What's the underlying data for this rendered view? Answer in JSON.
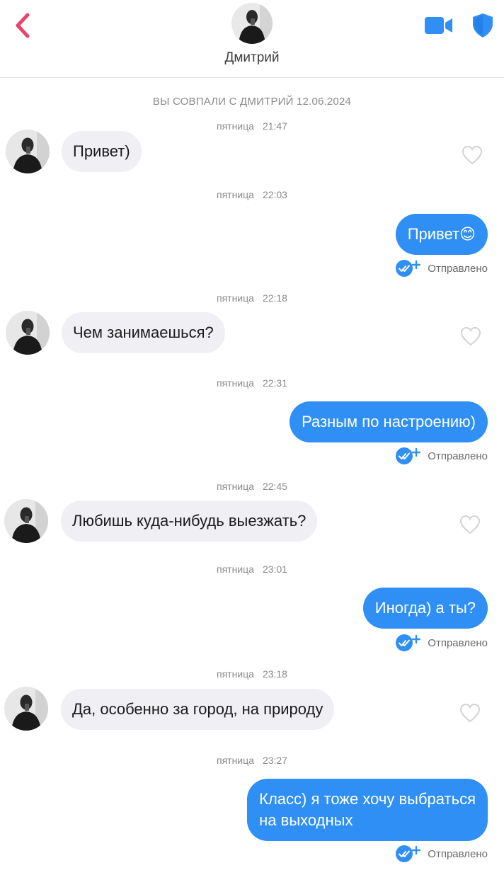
{
  "header": {
    "name": "Дмитрий",
    "accent_color": "#e8456b",
    "brand_color": "#2f8ff5",
    "icons": [
      "back-chevron-icon",
      "video-camera-icon",
      "shield-icon"
    ]
  },
  "chat": {
    "match_text": "ВЫ СОВПАЛИ С ДМИТРИЙ 12.06.2024",
    "messages": [
      {
        "direction": "in",
        "day": "пятница",
        "time": "21:47",
        "text": "Привет)"
      },
      {
        "direction": "out",
        "day": "пятница",
        "time": "22:03",
        "text": "Привет😊",
        "status": "Отправлено"
      },
      {
        "direction": "in",
        "day": "пятница",
        "time": "22:18",
        "text": "Чем занимаешься?"
      },
      {
        "direction": "out",
        "day": "пятница",
        "time": "22:31",
        "text": "Разным по настроению)",
        "status": "Отправлено"
      },
      {
        "direction": "in",
        "day": "пятница",
        "time": "22:45",
        "text": "Любишь куда-нибудь выезжать?"
      },
      {
        "direction": "out",
        "day": "пятница",
        "time": "23:01",
        "text": "Иногда) а ты?",
        "status": "Отправлено"
      },
      {
        "direction": "in",
        "day": "пятница",
        "time": "23:18",
        "text": "Да, особенно за город, на природу"
      },
      {
        "direction": "out",
        "day": "пятница",
        "time": "23:27",
        "text_line1": "Класс) я тоже хочу выбраться",
        "text_line2": "на выходных",
        "status": "Отправлено"
      }
    ]
  }
}
